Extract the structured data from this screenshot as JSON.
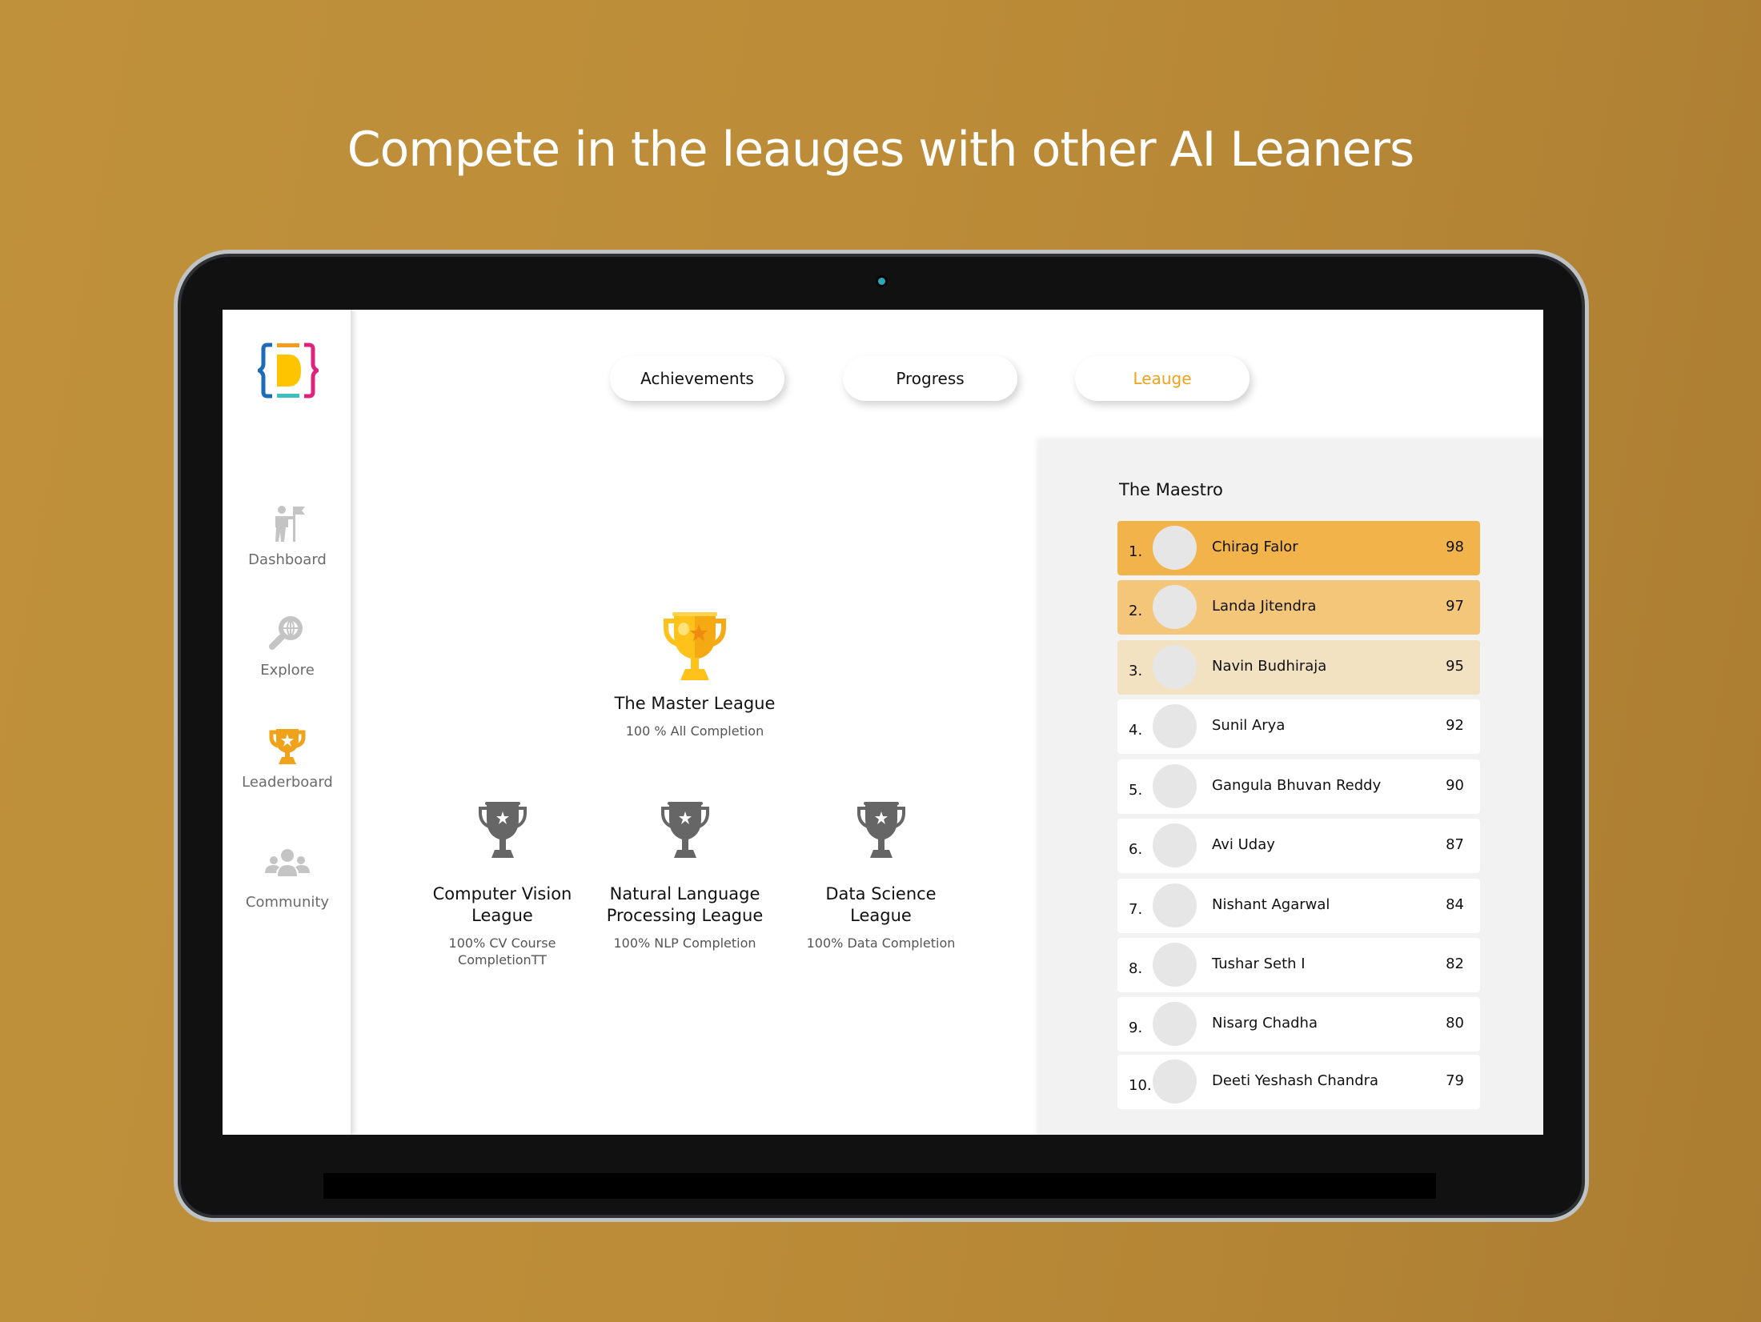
{
  "headline": "Compete in the leauges with other AI Leaners",
  "sidebar": {
    "logo": "dphi-logo",
    "items": [
      {
        "label": "Dashboard",
        "icon": "hiker-flag-icon",
        "active": false
      },
      {
        "label": "Explore",
        "icon": "magnifier-globe-icon",
        "active": false
      },
      {
        "label": "Leaderboard",
        "icon": "trophy-icon",
        "active": true
      },
      {
        "label": "Community",
        "icon": "group-icon",
        "active": false
      }
    ]
  },
  "tabs": [
    {
      "label": "Achievements",
      "active": false
    },
    {
      "label": "Progress",
      "active": false
    },
    {
      "label": "Leauge",
      "active": true
    }
  ],
  "leagues": {
    "master": {
      "title": "The Master League",
      "subtitle": "100 % All Completion",
      "icon": "gold-trophy-icon"
    },
    "others": [
      {
        "title_line1": "Computer Vision",
        "title_line2": "League",
        "sub_line1": "100% CV Course",
        "sub_line2": "CompletionTT",
        "icon": "gray-trophy-icon"
      },
      {
        "title_line1": "Natural Language",
        "title_line2": "Processing League",
        "sub_line1": "100% NLP Completion",
        "sub_line2": "",
        "icon": "gray-trophy-icon"
      },
      {
        "title_line1": "Data Science",
        "title_line2": "League",
        "sub_line1": "100% Data Completion",
        "sub_line2": "",
        "icon": "gray-trophy-icon"
      }
    ]
  },
  "leaderboard": {
    "title": "The Maestro",
    "rows": [
      {
        "rank": "1.",
        "name": "Chirag Falor",
        "score": "98"
      },
      {
        "rank": "2.",
        "name": "Landa Jitendra",
        "score": "97"
      },
      {
        "rank": "3.",
        "name": "Navin Budhiraja",
        "score": "95"
      },
      {
        "rank": "4.",
        "name": "Sunil Arya",
        "score": "92"
      },
      {
        "rank": "5.",
        "name": "Gangula Bhuvan Reddy",
        "score": "90"
      },
      {
        "rank": "6.",
        "name": "Avi Uday",
        "score": "87"
      },
      {
        "rank": "7.",
        "name": "Nishant Agarwal",
        "score": "84"
      },
      {
        "rank": "8.",
        "name": "Tushar Seth I",
        "score": "82"
      },
      {
        "rank": "9.",
        "name": "Nisarg Chadha",
        "score": "80"
      },
      {
        "rank": "10.",
        "name": "Deeti Yeshash Chandra",
        "score": "79"
      }
    ]
  },
  "colors": {
    "accent": "#f0a21b",
    "rank1": "#f2b44a",
    "rank2": "#f4c67a",
    "rank3": "#f2e2c2",
    "inactive_icon": "#c4c4c4",
    "gray_trophy": "#666666"
  }
}
